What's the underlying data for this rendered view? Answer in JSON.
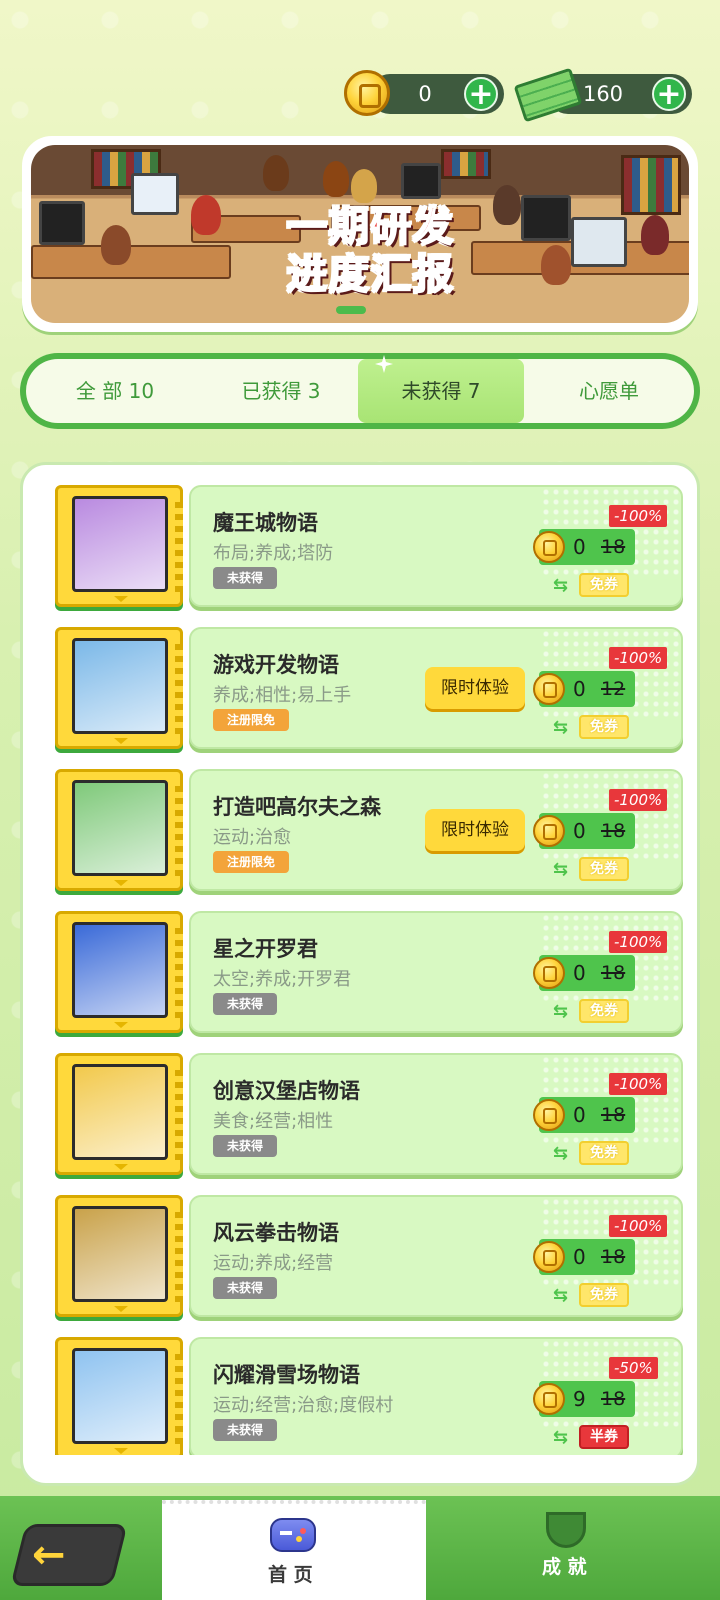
{
  "currency": {
    "coins": "0",
    "cash": "160"
  },
  "banner": {
    "title_line1": "一期研发",
    "title_line2": "进度汇报"
  },
  "tabs": [
    {
      "label": "全 部 10"
    },
    {
      "label": "已获得 3"
    },
    {
      "label": "未获得 7"
    },
    {
      "label": "心愿单"
    }
  ],
  "active_tab": 2,
  "games": [
    {
      "name": "魔王城物语",
      "tags": "布局;养成;塔防",
      "status": "未获得",
      "status_type": "gray",
      "trial": "",
      "price": "0",
      "original": "18",
      "discount": "-100%",
      "voucher": "免券",
      "art_color": "#b98ae0"
    },
    {
      "name": "游戏开发物语",
      "tags": "养成;相性;易上手",
      "status": "注册限免",
      "status_type": "orange",
      "trial": "限时体验",
      "price": "0",
      "original": "12",
      "discount": "-100%",
      "voucher": "免券",
      "art_color": "#7bb8e8"
    },
    {
      "name": "打造吧高尔夫之森",
      "tags": "运动;治愈",
      "status": "注册限免",
      "status_type": "orange",
      "trial": "限时体验",
      "price": "0",
      "original": "18",
      "discount": "-100%",
      "voucher": "免券",
      "art_color": "#7fc97a"
    },
    {
      "name": "星之开罗君",
      "tags": "太空;养成;开罗君",
      "status": "未获得",
      "status_type": "gray",
      "trial": "",
      "price": "0",
      "original": "18",
      "discount": "-100%",
      "voucher": "免券",
      "art_color": "#3a6ad8"
    },
    {
      "name": "创意汉堡店物语",
      "tags": "美食;经营;相性",
      "status": "未获得",
      "status_type": "gray",
      "trial": "",
      "price": "0",
      "original": "18",
      "discount": "-100%",
      "voucher": "免券",
      "art_color": "#f2c94c"
    },
    {
      "name": "风云拳击物语",
      "tags": "运动;养成;经营",
      "status": "未获得",
      "status_type": "gray",
      "trial": "",
      "price": "0",
      "original": "18",
      "discount": "-100%",
      "voucher": "免券",
      "art_color": "#c9a24a"
    },
    {
      "name": "闪耀滑雪场物语",
      "tags": "运动;经营;治愈;度假村",
      "status": "未获得",
      "status_type": "gray",
      "trial": "",
      "price": "9",
      "original": "18",
      "discount": "-50%",
      "voucher": "半券",
      "art_color": "#8fc3f0"
    }
  ],
  "nav": {
    "home": "首 页",
    "achievements": "成 就"
  },
  "colors": {
    "accent_green": "#4fb546",
    "discount_red": "#e8373b",
    "coin_gold": "#ffd43b"
  }
}
